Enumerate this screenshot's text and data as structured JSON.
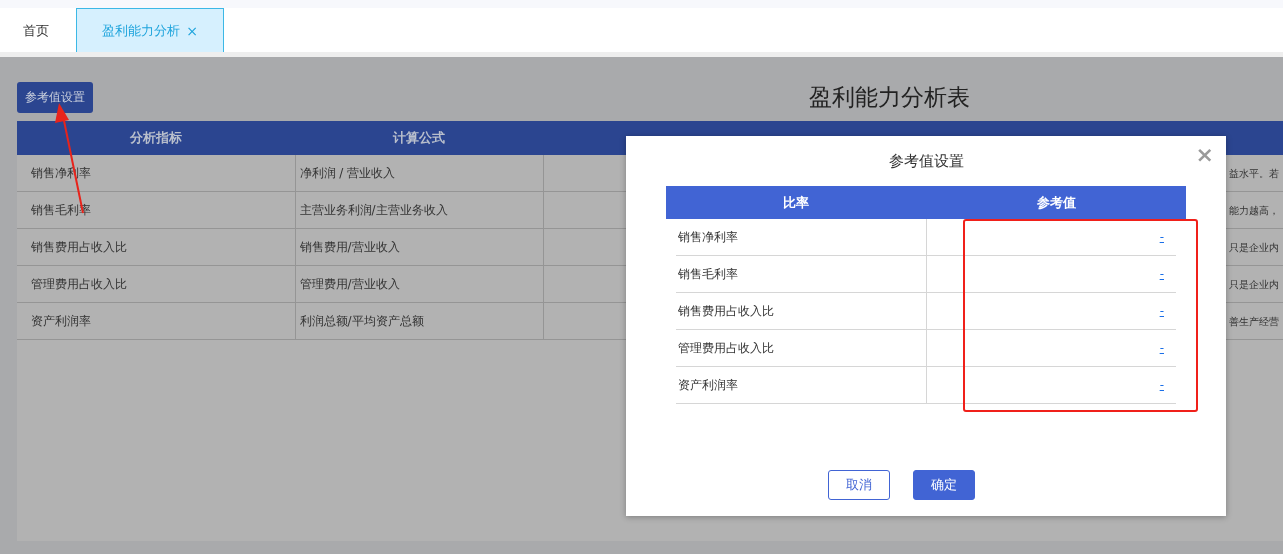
{
  "tabs": [
    {
      "label": "首页",
      "selected": false,
      "closable": false
    },
    {
      "label": "盈利能力分析",
      "selected": true,
      "closable": true,
      "close_icon": "×"
    }
  ],
  "settings_button": "参考值设置",
  "page_title": "盈利能力分析表",
  "table": {
    "columns": [
      "分析指标",
      "计算公式"
    ],
    "rows": [
      {
        "indicator": "销售净利率",
        "formula": "净利润 / 营业收入",
        "column_5": "益水平。若"
      },
      {
        "indicator": "销售毛利率",
        "formula": "主营业务利润/主营业务收入",
        "column_5": "能力越高，"
      },
      {
        "indicator": "销售费用占收入比",
        "formula": "销售费用/营业收入",
        "column_5": "只是企业内"
      },
      {
        "indicator": "管理费用占收入比",
        "formula": "管理费用/营业收入",
        "column_5": "只是企业内"
      },
      {
        "indicator": "资产利润率",
        "formula": "利润总额/平均资产总额",
        "column_5": "善生产经营"
      }
    ]
  },
  "dialog": {
    "title": "参考值设置",
    "close_icon": "×",
    "columns": [
      "比率",
      "参考值"
    ],
    "rows": [
      {
        "ratio": "销售净利率",
        "value": "-"
      },
      {
        "ratio": "销售毛利率",
        "value": "-"
      },
      {
        "ratio": "销售费用占收入比",
        "value": "-"
      },
      {
        "ratio": "管理费用占收入比",
        "value": "-"
      },
      {
        "ratio": "资产利润率",
        "value": "-"
      }
    ],
    "buttons": [
      {
        "label": "取消",
        "kind": "secondary"
      },
      {
        "label": "确定",
        "kind": "primary"
      }
    ]
  }
}
